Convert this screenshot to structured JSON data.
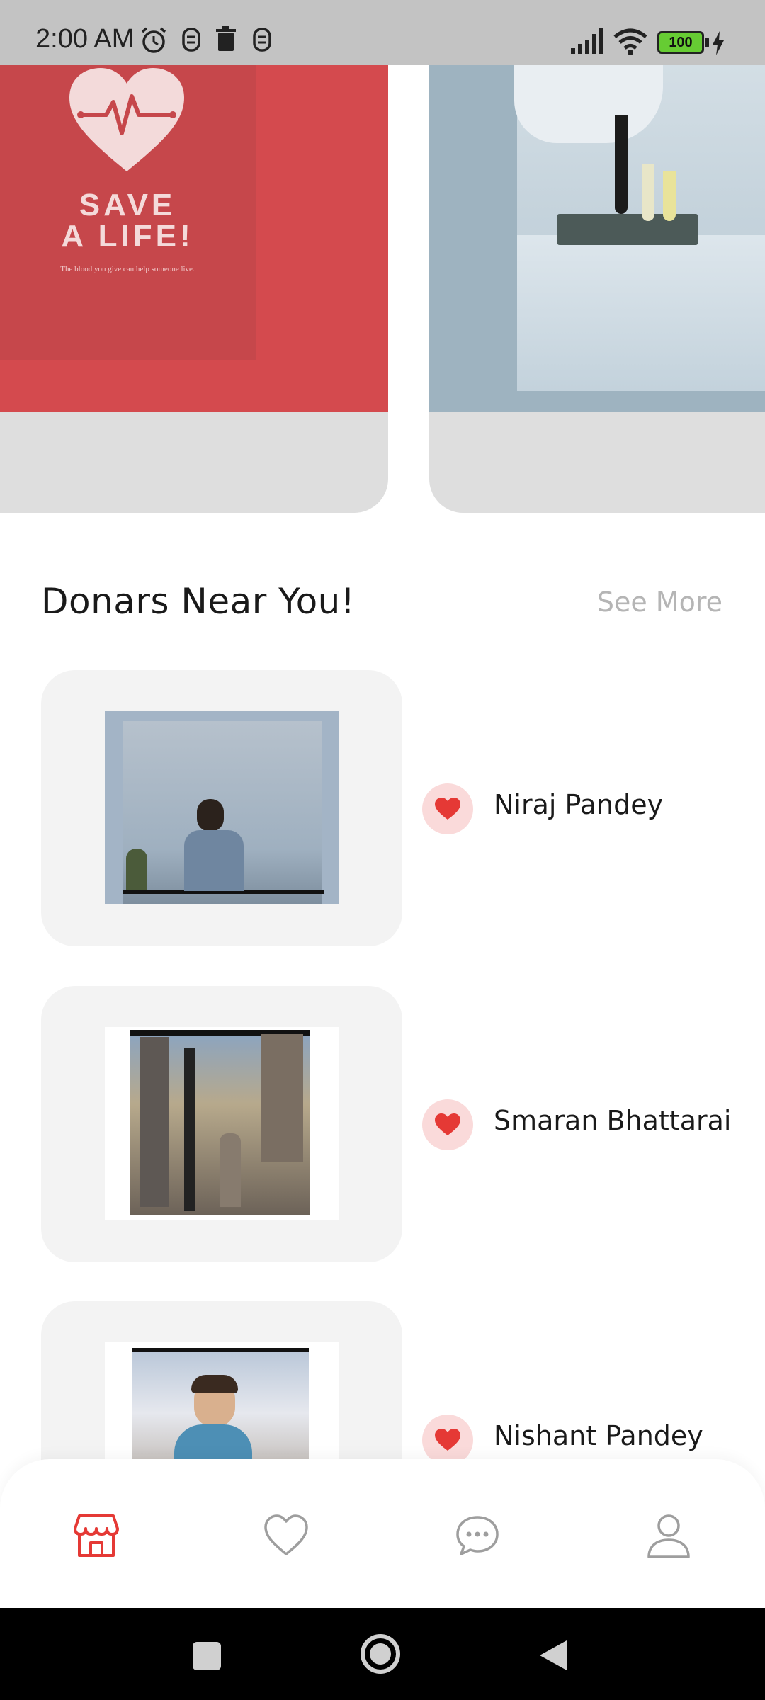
{
  "status_bar": {
    "time": "2:00 AM",
    "battery": "100",
    "icons": [
      "alarm-icon",
      "notification-icon",
      "delete-icon",
      "notification-icon",
      "signal-icon",
      "wifi-icon",
      "battery-icon",
      "charging-icon"
    ]
  },
  "carousel": {
    "slides": [
      {
        "title": "SAVE\nA LIFE!",
        "subtitle": "The blood you give can help someone live."
      },
      {
        "image": "lab-test-tubes"
      }
    ]
  },
  "donors_section": {
    "title": "Donars Near You!",
    "see_more": "See More",
    "donors": [
      {
        "name": "Niraj Pandey"
      },
      {
        "name": "Smaran Bhattarai"
      },
      {
        "name": "Nishant Pandey"
      }
    ]
  },
  "bottom_nav": {
    "items": [
      "store-icon",
      "heart-icon",
      "chat-icon",
      "profile-icon"
    ],
    "active_color": "#e53935",
    "inactive_color": "#9e9e9e"
  },
  "colors": {
    "accent": "#e53935",
    "banner_red": "#d44a4e",
    "heart_bg": "#fadada"
  }
}
